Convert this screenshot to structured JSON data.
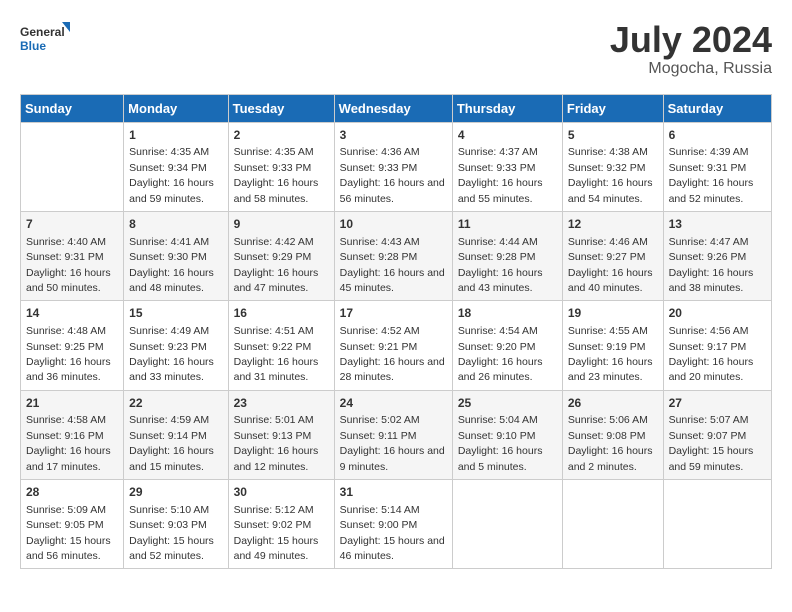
{
  "logo": {
    "line1": "General",
    "line2": "Blue"
  },
  "title": "July 2024",
  "location": "Mogocha, Russia",
  "days_header": [
    "Sunday",
    "Monday",
    "Tuesday",
    "Wednesday",
    "Thursday",
    "Friday",
    "Saturday"
  ],
  "weeks": [
    [
      {
        "day": "",
        "sunrise": "",
        "sunset": "",
        "daylight": ""
      },
      {
        "day": "1",
        "sunrise": "Sunrise: 4:35 AM",
        "sunset": "Sunset: 9:34 PM",
        "daylight": "Daylight: 16 hours and 59 minutes."
      },
      {
        "day": "2",
        "sunrise": "Sunrise: 4:35 AM",
        "sunset": "Sunset: 9:33 PM",
        "daylight": "Daylight: 16 hours and 58 minutes."
      },
      {
        "day": "3",
        "sunrise": "Sunrise: 4:36 AM",
        "sunset": "Sunset: 9:33 PM",
        "daylight": "Daylight: 16 hours and 56 minutes."
      },
      {
        "day": "4",
        "sunrise": "Sunrise: 4:37 AM",
        "sunset": "Sunset: 9:33 PM",
        "daylight": "Daylight: 16 hours and 55 minutes."
      },
      {
        "day": "5",
        "sunrise": "Sunrise: 4:38 AM",
        "sunset": "Sunset: 9:32 PM",
        "daylight": "Daylight: 16 hours and 54 minutes."
      },
      {
        "day": "6",
        "sunrise": "Sunrise: 4:39 AM",
        "sunset": "Sunset: 9:31 PM",
        "daylight": "Daylight: 16 hours and 52 minutes."
      }
    ],
    [
      {
        "day": "7",
        "sunrise": "Sunrise: 4:40 AM",
        "sunset": "Sunset: 9:31 PM",
        "daylight": "Daylight: 16 hours and 50 minutes."
      },
      {
        "day": "8",
        "sunrise": "Sunrise: 4:41 AM",
        "sunset": "Sunset: 9:30 PM",
        "daylight": "Daylight: 16 hours and 48 minutes."
      },
      {
        "day": "9",
        "sunrise": "Sunrise: 4:42 AM",
        "sunset": "Sunset: 9:29 PM",
        "daylight": "Daylight: 16 hours and 47 minutes."
      },
      {
        "day": "10",
        "sunrise": "Sunrise: 4:43 AM",
        "sunset": "Sunset: 9:28 PM",
        "daylight": "Daylight: 16 hours and 45 minutes."
      },
      {
        "day": "11",
        "sunrise": "Sunrise: 4:44 AM",
        "sunset": "Sunset: 9:28 PM",
        "daylight": "Daylight: 16 hours and 43 minutes."
      },
      {
        "day": "12",
        "sunrise": "Sunrise: 4:46 AM",
        "sunset": "Sunset: 9:27 PM",
        "daylight": "Daylight: 16 hours and 40 minutes."
      },
      {
        "day": "13",
        "sunrise": "Sunrise: 4:47 AM",
        "sunset": "Sunset: 9:26 PM",
        "daylight": "Daylight: 16 hours and 38 minutes."
      }
    ],
    [
      {
        "day": "14",
        "sunrise": "Sunrise: 4:48 AM",
        "sunset": "Sunset: 9:25 PM",
        "daylight": "Daylight: 16 hours and 36 minutes."
      },
      {
        "day": "15",
        "sunrise": "Sunrise: 4:49 AM",
        "sunset": "Sunset: 9:23 PM",
        "daylight": "Daylight: 16 hours and 33 minutes."
      },
      {
        "day": "16",
        "sunrise": "Sunrise: 4:51 AM",
        "sunset": "Sunset: 9:22 PM",
        "daylight": "Daylight: 16 hours and 31 minutes."
      },
      {
        "day": "17",
        "sunrise": "Sunrise: 4:52 AM",
        "sunset": "Sunset: 9:21 PM",
        "daylight": "Daylight: 16 hours and 28 minutes."
      },
      {
        "day": "18",
        "sunrise": "Sunrise: 4:54 AM",
        "sunset": "Sunset: 9:20 PM",
        "daylight": "Daylight: 16 hours and 26 minutes."
      },
      {
        "day": "19",
        "sunrise": "Sunrise: 4:55 AM",
        "sunset": "Sunset: 9:19 PM",
        "daylight": "Daylight: 16 hours and 23 minutes."
      },
      {
        "day": "20",
        "sunrise": "Sunrise: 4:56 AM",
        "sunset": "Sunset: 9:17 PM",
        "daylight": "Daylight: 16 hours and 20 minutes."
      }
    ],
    [
      {
        "day": "21",
        "sunrise": "Sunrise: 4:58 AM",
        "sunset": "Sunset: 9:16 PM",
        "daylight": "Daylight: 16 hours and 17 minutes."
      },
      {
        "day": "22",
        "sunrise": "Sunrise: 4:59 AM",
        "sunset": "Sunset: 9:14 PM",
        "daylight": "Daylight: 16 hours and 15 minutes."
      },
      {
        "day": "23",
        "sunrise": "Sunrise: 5:01 AM",
        "sunset": "Sunset: 9:13 PM",
        "daylight": "Daylight: 16 hours and 12 minutes."
      },
      {
        "day": "24",
        "sunrise": "Sunrise: 5:02 AM",
        "sunset": "Sunset: 9:11 PM",
        "daylight": "Daylight: 16 hours and 9 minutes."
      },
      {
        "day": "25",
        "sunrise": "Sunrise: 5:04 AM",
        "sunset": "Sunset: 9:10 PM",
        "daylight": "Daylight: 16 hours and 5 minutes."
      },
      {
        "day": "26",
        "sunrise": "Sunrise: 5:06 AM",
        "sunset": "Sunset: 9:08 PM",
        "daylight": "Daylight: 16 hours and 2 minutes."
      },
      {
        "day": "27",
        "sunrise": "Sunrise: 5:07 AM",
        "sunset": "Sunset: 9:07 PM",
        "daylight": "Daylight: 15 hours and 59 minutes."
      }
    ],
    [
      {
        "day": "28",
        "sunrise": "Sunrise: 5:09 AM",
        "sunset": "Sunset: 9:05 PM",
        "daylight": "Daylight: 15 hours and 56 minutes."
      },
      {
        "day": "29",
        "sunrise": "Sunrise: 5:10 AM",
        "sunset": "Sunset: 9:03 PM",
        "daylight": "Daylight: 15 hours and 52 minutes."
      },
      {
        "day": "30",
        "sunrise": "Sunrise: 5:12 AM",
        "sunset": "Sunset: 9:02 PM",
        "daylight": "Daylight: 15 hours and 49 minutes."
      },
      {
        "day": "31",
        "sunrise": "Sunrise: 5:14 AM",
        "sunset": "Sunset: 9:00 PM",
        "daylight": "Daylight: 15 hours and 46 minutes."
      },
      {
        "day": "",
        "sunrise": "",
        "sunset": "",
        "daylight": ""
      },
      {
        "day": "",
        "sunrise": "",
        "sunset": "",
        "daylight": ""
      },
      {
        "day": "",
        "sunrise": "",
        "sunset": "",
        "daylight": ""
      }
    ]
  ]
}
